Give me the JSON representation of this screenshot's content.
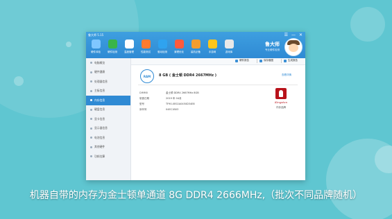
{
  "window": {
    "app_title": "鲁大师 5.15",
    "controls": [
      "☰",
      "—",
      "✕"
    ]
  },
  "toolbar": [
    {
      "label": "硬件体检",
      "color": "#7fc7ff",
      "icon": "monitor-icon"
    },
    {
      "label": "硬件检测",
      "color": "#39b54a",
      "icon": "chip-icon"
    },
    {
      "label": "温度管理",
      "color": "#ffffff",
      "icon": "thermometer-icon"
    },
    {
      "label": "性能测试",
      "color": "#ff7b2f",
      "icon": "gauge-icon"
    },
    {
      "label": "驱动检测",
      "color": "#2fa3ef",
      "icon": "gear-icon"
    },
    {
      "label": "清理优化",
      "color": "#ff5a3d",
      "icon": "broom-icon"
    },
    {
      "label": "装机必备",
      "color": "#f29d2f",
      "icon": "box-icon"
    },
    {
      "label": "手游网",
      "color": "#ffc61a",
      "icon": "gamepad-icon"
    },
    {
      "label": "游戏库",
      "color": "#e8e8e8",
      "icon": "controller-icon"
    }
  ],
  "brand": {
    "name": "鲁大师",
    "subtitle": "专业硬件检测"
  },
  "subbar": {
    "btn1": "硬件报告",
    "btn2": "保存截图",
    "btn3": "生成报告"
  },
  "sidebar": {
    "items": [
      {
        "label": "电脑概览",
        "active": false
      },
      {
        "label": "硬件健康",
        "active": false
      },
      {
        "label": "处理器信息",
        "active": false
      },
      {
        "label": "主板信息",
        "active": false
      },
      {
        "label": "内存信息",
        "active": true
      },
      {
        "label": "硬盘信息",
        "active": false
      },
      {
        "label": "显卡信息",
        "active": false
      },
      {
        "label": "显示器信息",
        "active": false
      },
      {
        "label": "电池信息",
        "active": false
      },
      {
        "label": "其他硬件",
        "active": false
      },
      {
        "label": "功耗估算",
        "active": false
      }
    ]
  },
  "memory": {
    "icon_label": "RAM",
    "title": "8 GB ( 金士顿 DDR4 2667MHz )",
    "link": "查看详情",
    "properties": [
      {
        "key": "DIMM0",
        "value": "金士顿 DDR4 2667MHz 8GB"
      },
      {
        "key": "制造日期",
        "value": "2019 年 04月"
      },
      {
        "key": "型号",
        "value": "TF90-0E02A0450D34E8"
      },
      {
        "key": "序列号",
        "value": "04EC1B03"
      }
    ],
    "vendor_logo_text": "Kingston",
    "vendor_caption": "内存品牌"
  },
  "caption": "机器自带的内存为金士顿单通道 8G DDR4 2666MHz,（批次不同品牌随机）"
}
